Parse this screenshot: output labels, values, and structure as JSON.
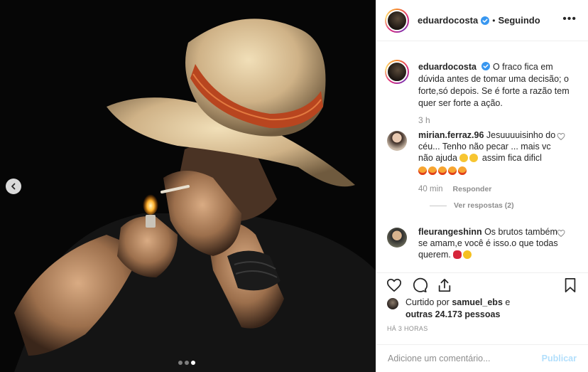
{
  "post": {
    "username": "eduardocosta",
    "follow_separator": "•",
    "follow_status": "Seguindo",
    "more_label": "•••",
    "caption": "O fraco fica em dúvida antes de tomar uma decisão; o forte,só depois. Se é forte a razão tem quer ser forte a ação.",
    "caption_time": "3 h"
  },
  "comments": [
    {
      "username": "mirian.ferraz.96",
      "text": "Jesuuuuisinho do céu... Tenho não pecar ... mais vc não ajuda",
      "text_tail": "assim fica dificl",
      "time": "40 min",
      "reply_label": "Responder",
      "view_replies": "Ver respostas (2)"
    },
    {
      "username": "fleurangeshinn",
      "text": "Os brutos também se amam,e você é isso.o que todas querem."
    }
  ],
  "likes": {
    "prefix": "Curtido por",
    "user": "samuel_ebs",
    "connector": "e",
    "others": "outras 24.173 pessoas"
  },
  "time_ago": "HÁ 3 HORAS",
  "composer": {
    "placeholder": "Adicione um comentário...",
    "publish_label": "Publicar"
  },
  "carousel": {
    "slides": 3,
    "active_index": 2
  },
  "colors": {
    "accent_blue": "#3897f0",
    "publish_disabled": "#b2dffc",
    "muted": "#8e8e8e"
  },
  "icons": [
    "chevron-left-icon",
    "verified-badge-icon",
    "more-options-icon",
    "heart-icon",
    "comment-icon",
    "share-icon",
    "bookmark-icon"
  ]
}
